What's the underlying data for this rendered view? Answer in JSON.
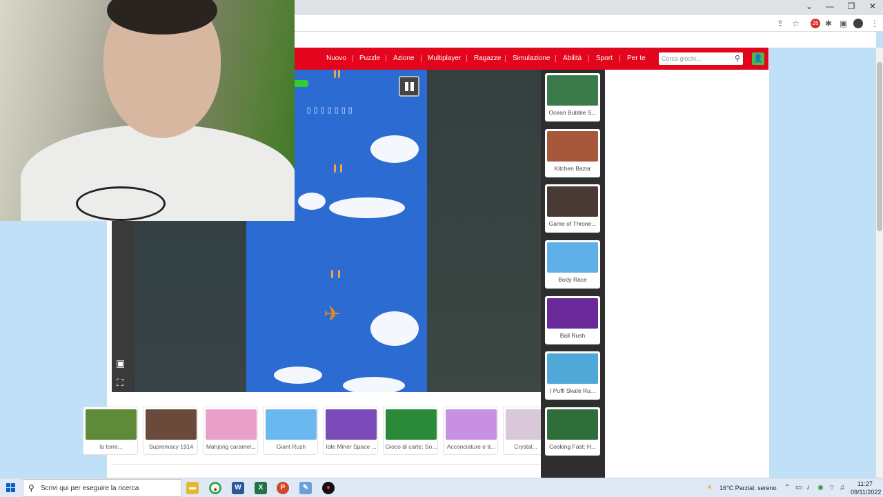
{
  "browser": {
    "window_controls": {
      "dropdown": "⌄",
      "minimize": "—",
      "restore": "❐",
      "close": "✕"
    },
    "extension_badge": "26"
  },
  "nav": {
    "items": [
      "Nuovo",
      "Puzzle",
      "Azione",
      "Multiplayer",
      "Ragazze",
      "Simulazione",
      "Abilità",
      "Sport",
      "Per te"
    ],
    "search_placeholder": "Cerca giochi...",
    "accent": "#e2051c"
  },
  "game": {
    "score": "▯▯▯▯▯▯▯",
    "sky_color": "#2c6bd2"
  },
  "sidebar_games": [
    {
      "label": "Ocean Bubble S...",
      "color": "#3b7a4a"
    },
    {
      "label": "Kitchen Bazar",
      "color": "#a8583a"
    },
    {
      "label": "Game of Throne...",
      "color": "#4a3a34"
    },
    {
      "label": "Body Race",
      "color": "#5fb0e8"
    },
    {
      "label": "Ball Rush",
      "color": "#6a2a9a"
    },
    {
      "label": "I Puffi Skate Ru...",
      "color": "#4fa8d8"
    },
    {
      "label": "Cooking Fast: H...",
      "color": "#2f6e3a"
    }
  ],
  "bottom_games": [
    {
      "label": "la torre...",
      "color": "#5e8a3a"
    },
    {
      "label": "Supremacy 1914",
      "color": "#6a4a3a"
    },
    {
      "label": "Mahjong caramel...",
      "color": "#e8a0c8"
    },
    {
      "label": "Giant Rush",
      "color": "#6ab8f0"
    },
    {
      "label": "Idle Miner Space ...",
      "color": "#7a4ab8"
    },
    {
      "label": "Gioco di carte: So...",
      "color": "#2a8a3a"
    },
    {
      "label": "Acconciature e tr...",
      "color": "#c890e0"
    },
    {
      "label": "Crystal...",
      "color": "#d8c8d8"
    }
  ],
  "taskbar": {
    "search_text": "Scrivi qui per eseguire la ricerca",
    "weather": "16°C  Parzial. sereno",
    "time": "11:27",
    "date": "09/11/2022"
  }
}
